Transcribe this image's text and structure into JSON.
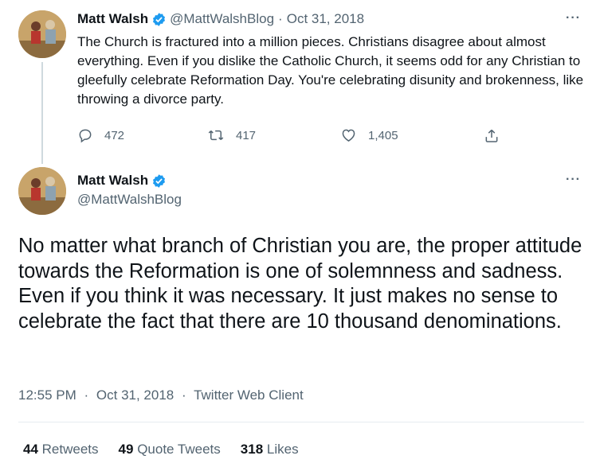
{
  "reply_tweet": {
    "author_name": "Matt Walsh",
    "handle": "@MattWalshBlog",
    "separator": "·",
    "date": "Oct 31, 2018",
    "more": "···",
    "text": "The Church is fractured into a million pieces. Christians disagree about almost everything. Even if you dislike the Catholic Church, it seems odd for any Christian to gleefully celebrate Reformation Day. You're celebrating disunity and brokenness, like throwing a divorce party.",
    "actions": {
      "replies": "472",
      "retweets": "417",
      "likes": "1,405"
    }
  },
  "main_tweet": {
    "author_name": "Matt Walsh",
    "handle": "@MattWalshBlog",
    "more": "···",
    "text": "No matter what branch of Christian you are, the proper attitude towards the Reformation is one of solemnness and sadness. Even if you think it was necessary. It just makes no sense to celebrate the fact that there are 10 thousand denominations.",
    "time": "12:55 PM",
    "date": "Oct 31, 2018",
    "client": "Twitter Web Client",
    "meta_separator": "·",
    "stats": {
      "retweets_count": "44",
      "retweets_label": "Retweets",
      "quotes_count": "49",
      "quotes_label": "Quote Tweets",
      "likes_count": "318",
      "likes_label": "Likes"
    }
  },
  "colors": {
    "verified_blue": "#1d9bf0",
    "secondary_text": "#536471",
    "primary_text": "#0f1419"
  },
  "icons": [
    "reply-icon",
    "retweet-icon",
    "like-icon",
    "share-icon",
    "verified-badge-icon",
    "more-icon"
  ]
}
